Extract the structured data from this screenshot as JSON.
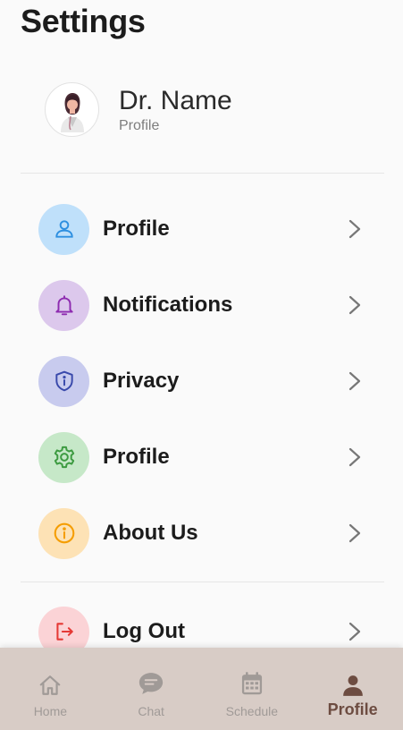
{
  "page": {
    "title": "Settings"
  },
  "profile": {
    "name": "Dr. Name",
    "subtitle": "Profile"
  },
  "menu": [
    {
      "label": "Profile",
      "icon": "person-icon",
      "bg": "#bfe0fa",
      "color": "#2d8fe0"
    },
    {
      "label": "Notifications",
      "icon": "bell-icon",
      "bg": "#dcc8ec",
      "color": "#8e2bb0"
    },
    {
      "label": "Privacy",
      "icon": "shield-info-icon",
      "bg": "#c8cbee",
      "color": "#3949ab"
    },
    {
      "label": "Profile",
      "icon": "gear-icon",
      "bg": "#c6e8c8",
      "color": "#3d9b41"
    },
    {
      "label": "About Us",
      "icon": "info-circle-icon",
      "bg": "#fde2b5",
      "color": "#f59d00"
    },
    {
      "label": "Log Out",
      "icon": "logout-icon",
      "bg": "#fbd3d6",
      "color": "#e53935"
    }
  ],
  "bottom_nav": [
    {
      "label": "Home",
      "icon": "home-icon",
      "active": false
    },
    {
      "label": "Chat",
      "icon": "chat-icon",
      "active": false
    },
    {
      "label": "Schedule",
      "icon": "calendar-icon",
      "active": false
    },
    {
      "label": "Profile",
      "icon": "person-icon",
      "active": true
    }
  ],
  "colors": {
    "nav_background": "#d8ccc6",
    "nav_active": "#6d4c41",
    "nav_inactive": "#a09a97",
    "chevron": "#777777"
  }
}
